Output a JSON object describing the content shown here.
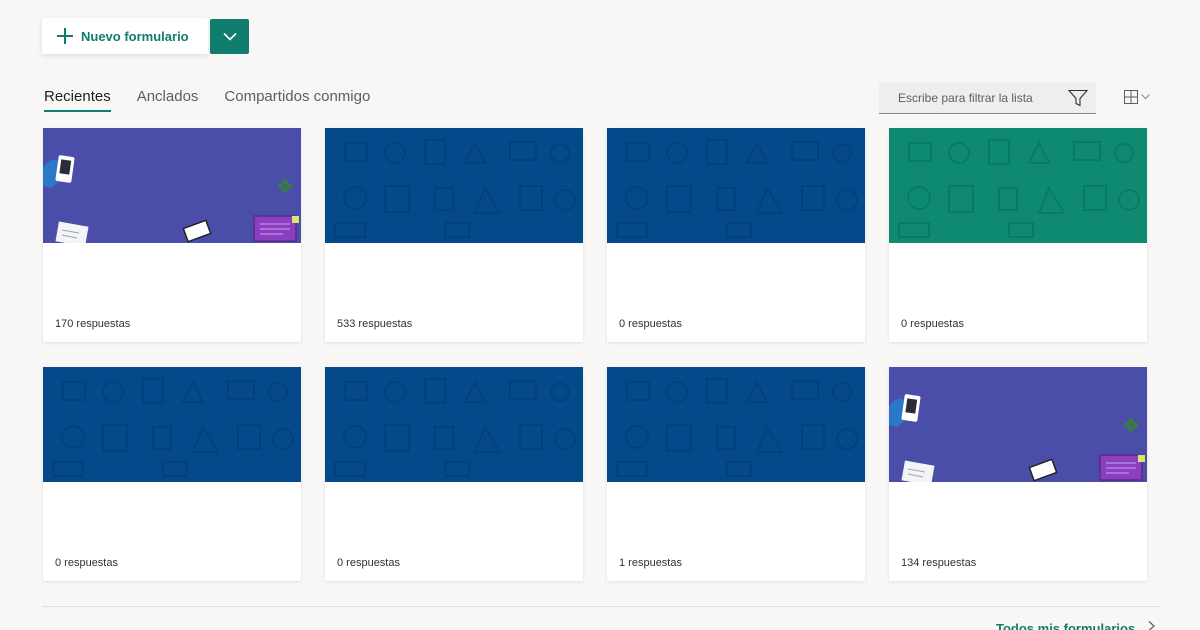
{
  "toolbar": {
    "new_form_label": "Nuevo formulario"
  },
  "tabs": [
    {
      "label": "Recientes",
      "active": true
    },
    {
      "label": "Anclados",
      "active": false
    },
    {
      "label": "Compartidos conmigo",
      "active": false
    }
  ],
  "filter": {
    "placeholder": "Escribe para filtrar la lista"
  },
  "colors": {
    "accent": "#107c6d",
    "theme_purple": "#4a4ea8",
    "theme_blue": "#044a8a",
    "theme_green": "#0e8a71"
  },
  "cards": [
    {
      "theme": "purple",
      "responses": "170 respuestas"
    },
    {
      "theme": "blue",
      "responses": "533 respuestas"
    },
    {
      "theme": "blue",
      "responses": "0 respuestas"
    },
    {
      "theme": "green",
      "responses": "0 respuestas"
    },
    {
      "theme": "blue",
      "responses": "0 respuestas"
    },
    {
      "theme": "blue",
      "responses": "0 respuestas"
    },
    {
      "theme": "blue",
      "responses": "1 respuestas"
    },
    {
      "theme": "purple",
      "responses": "134 respuestas"
    }
  ],
  "footer": {
    "all_forms_label": "Todos mis formularios"
  }
}
